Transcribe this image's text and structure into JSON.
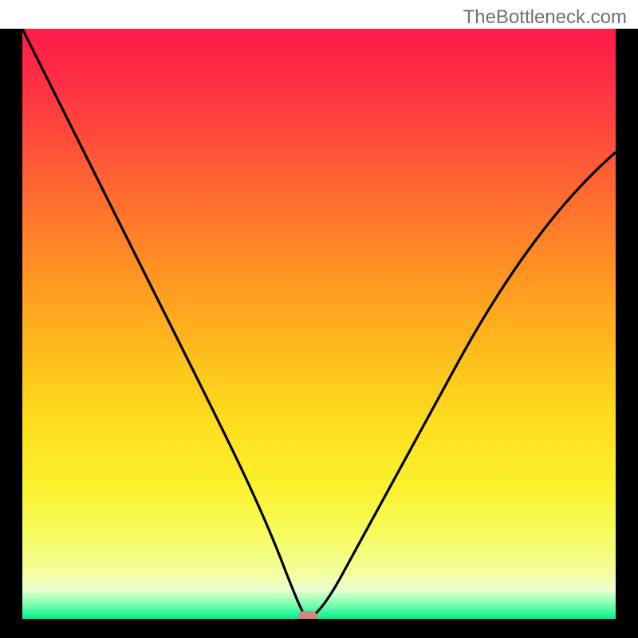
{
  "watermark": "TheBottleneck.com",
  "chart_data": {
    "type": "line",
    "title": "",
    "xlabel": "",
    "ylabel": "",
    "xrange": [
      0,
      100
    ],
    "yrange": [
      0,
      100
    ],
    "series": [
      {
        "name": "curve",
        "x": [
          0,
          5,
          10,
          15,
          20,
          25,
          30,
          35,
          40,
          43,
          45,
          47,
          48,
          50,
          55,
          60,
          65,
          70,
          75,
          80,
          85,
          90,
          95,
          100
        ],
        "y": [
          100,
          90,
          80,
          70,
          60,
          50,
          40,
          30,
          18,
          9,
          3,
          0.5,
          0,
          1,
          7,
          16,
          26,
          36,
          45,
          53,
          60,
          66,
          71,
          75
        ]
      }
    ],
    "marker": {
      "x": 48,
      "y": 0
    },
    "gradient_stops": [
      {
        "pos": 0.0,
        "color": "#ff1b4a"
      },
      {
        "pos": 0.5,
        "color": "#ffbb1c"
      },
      {
        "pos": 0.85,
        "color": "#f7fb59"
      },
      {
        "pos": 1.0,
        "color": "#00ef8f"
      }
    ]
  }
}
